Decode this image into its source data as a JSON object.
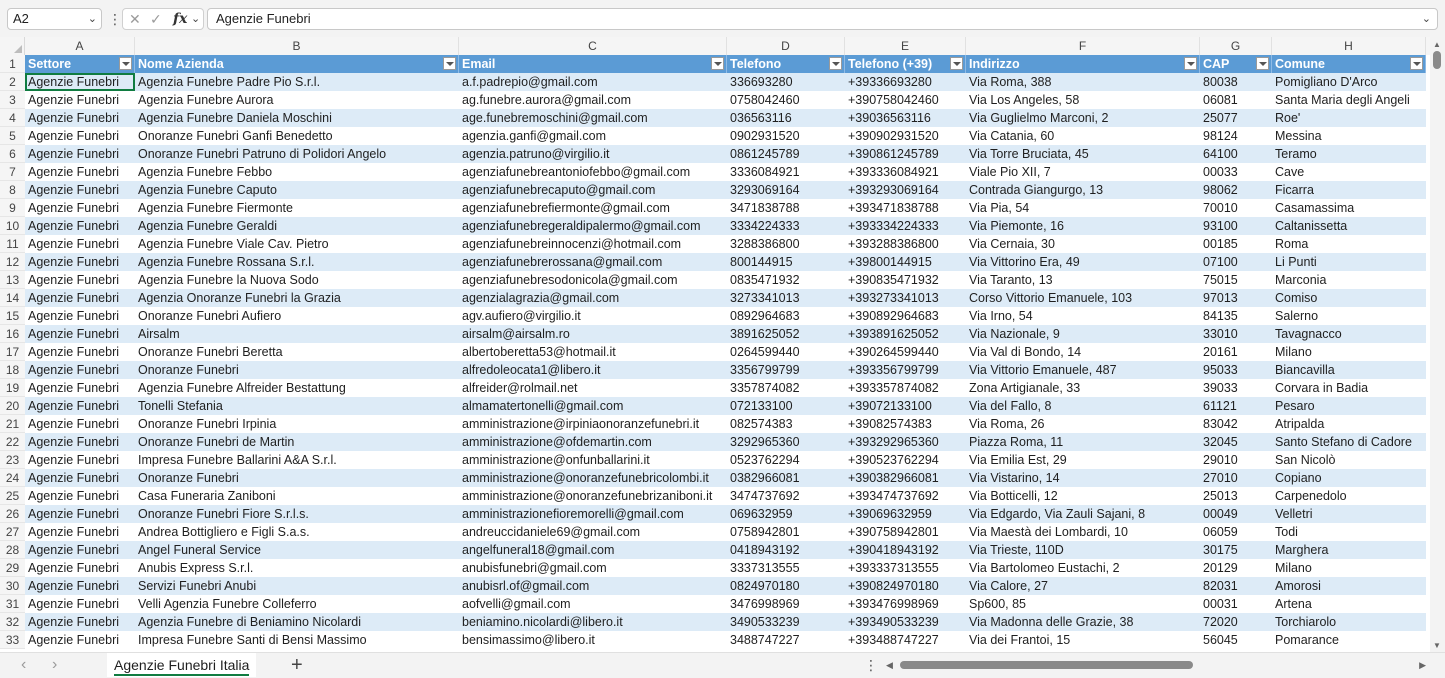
{
  "formula_bar": {
    "cell_ref": "A2",
    "fx_symbol": "fx",
    "cancel_symbol": "✕",
    "enter_symbol": "✓",
    "formula_value": "Agenzie Funebri"
  },
  "columns": [
    "A",
    "B",
    "C",
    "D",
    "E",
    "F",
    "G",
    "H"
  ],
  "header": [
    "Settore",
    "Nome Azienda",
    "Email",
    "Telefono",
    "Telefono (+39)",
    "Indirizzo",
    "CAP",
    "Comune"
  ],
  "rows": [
    [
      "Agenzie Funebri",
      "Agenzia Funebre Padre Pio S.r.l.",
      "a.f.padrepio@gmail.com",
      "336693280",
      "+39336693280",
      "Via Roma, 388",
      "80038",
      "Pomigliano D'Arco"
    ],
    [
      "Agenzie Funebri",
      "Agenzia Funebre Aurora",
      "ag.funebre.aurora@gmail.com",
      "0758042460",
      "+390758042460",
      "Via Los Angeles, 58",
      "06081",
      "Santa Maria degli Angeli"
    ],
    [
      "Agenzie Funebri",
      "Agenzia Funebre Daniela Moschini",
      "age.funebremoschini@gmail.com",
      "036563116",
      "+39036563116",
      "Via Guglielmo Marconi, 2",
      "25077",
      "Roe'"
    ],
    [
      "Agenzie Funebri",
      "Onoranze Funebri Ganfi Benedetto",
      "agenzia.ganfi@gmail.com",
      "0902931520",
      "+390902931520",
      "Via Catania, 60",
      "98124",
      "Messina"
    ],
    [
      "Agenzie Funebri",
      "Onoranze Funebri Patruno di Polidori Angelo",
      "agenzia.patruno@virgilio.it",
      "0861245789",
      "+390861245789",
      "Via Torre Bruciata, 45",
      "64100",
      "Teramo"
    ],
    [
      "Agenzie Funebri",
      "Agenzia Funebre Febbo",
      "agenziafunebreantoniofebbo@gmail.com",
      "3336084921",
      "+393336084921",
      "Viale Pio XII, 7",
      "00033",
      "Cave"
    ],
    [
      "Agenzie Funebri",
      "Agenzia Funebre Caputo",
      "agenziafunebrecaputo@gmail.com",
      "3293069164",
      "+393293069164",
      "Contrada Giangurgo, 13",
      "98062",
      "Ficarra"
    ],
    [
      "Agenzie Funebri",
      "Agenzia Funebre Fiermonte",
      "agenziafunebrefiermonte@gmail.com",
      "3471838788",
      "+393471838788",
      "Via Pia, 54",
      "70010",
      "Casamassima"
    ],
    [
      "Agenzie Funebri",
      "Agenzia Funebre Geraldi",
      "agenziafunebregeraldipalermo@gmail.com",
      "3334224333",
      "+393334224333",
      "Via Piemonte, 16",
      "93100",
      "Caltanissetta"
    ],
    [
      "Agenzie Funebri",
      "Agenzia Funebre Viale Cav. Pietro",
      "agenziafunebreinnocenzi@hotmail.com",
      "3288386800",
      "+393288386800",
      "Via Cernaia, 30",
      "00185",
      "Roma"
    ],
    [
      "Agenzie Funebri",
      "Agenzia Funebre Rossana S.r.l.",
      "agenziafunebrerossana@gmail.com",
      "800144915",
      "+39800144915",
      "Via Vittorino Era, 49",
      "07100",
      "Li Punti"
    ],
    [
      "Agenzie Funebri",
      "Agenzia Funebre la Nuova Sodo",
      "agenziafunebresodonicola@gmail.com",
      "0835471932",
      "+390835471932",
      "Via Taranto, 13",
      "75015",
      "Marconia"
    ],
    [
      "Agenzie Funebri",
      "Agenzia Onoranze Funebri la Grazia",
      "agenzialagrazia@gmail.com",
      "3273341013",
      "+393273341013",
      "Corso Vittorio Emanuele, 103",
      "97013",
      "Comiso"
    ],
    [
      "Agenzie Funebri",
      "Onoranze Funebri Aufiero",
      "agv.aufiero@virgilio.it",
      "0892964683",
      "+390892964683",
      "Via Irno, 54",
      "84135",
      "Salerno"
    ],
    [
      "Agenzie Funebri",
      "Airsalm",
      "airsalm@airsalm.ro",
      "3891625052",
      "+393891625052",
      "Via Nazionale, 9",
      "33010",
      "Tavagnacco"
    ],
    [
      "Agenzie Funebri",
      "Onoranze Funebri Beretta",
      "albertoberetta53@hotmail.it",
      "0264599440",
      "+390264599440",
      "Via Val di Bondo, 14",
      "20161",
      "Milano"
    ],
    [
      "Agenzie Funebri",
      "Onoranze Funebri",
      "alfredoleocata1@libero.it",
      "3356799799",
      "+393356799799",
      "Via Vittorio Emanuele, 487",
      "95033",
      "Biancavilla"
    ],
    [
      "Agenzie Funebri",
      "Agenzia Funebre Alfreider Bestattung",
      "alfreider@rolmail.net",
      "3357874082",
      "+393357874082",
      "Zona Artigianale, 33",
      "39033",
      "Corvara in Badia"
    ],
    [
      "Agenzie Funebri",
      "Tonelli Stefania",
      "almamatertonelli@gmail.com",
      "072133100",
      "+39072133100",
      "Via del Fallo, 8",
      "61121",
      "Pesaro"
    ],
    [
      "Agenzie Funebri",
      "Onoranze Funebri Irpinia",
      "amministrazione@irpiniaonoranzefunebri.it",
      "082574383",
      "+39082574383",
      "Via Roma, 26",
      "83042",
      "Atripalda"
    ],
    [
      "Agenzie Funebri",
      "Onoranze Funebri de Martin",
      "amministrazione@ofdemartin.com",
      "3292965360",
      "+393292965360",
      "Piazza Roma, 11",
      "32045",
      "Santo Stefano di Cadore"
    ],
    [
      "Agenzie Funebri",
      "Impresa Funebre Ballarini A&A S.r.l.",
      "amministrazione@onfunballarini.it",
      "0523762294",
      "+390523762294",
      "Via Emilia Est, 29",
      "29010",
      "San Nicolò"
    ],
    [
      "Agenzie Funebri",
      "Onoranze Funebri",
      "amministrazione@onoranzefunebricolombi.it",
      "0382966081",
      "+390382966081",
      "Via Vistarino, 14",
      "27010",
      "Copiano"
    ],
    [
      "Agenzie Funebri",
      "Casa Funeraria Zaniboni",
      "amministrazione@onoranzefunebrizaniboni.it",
      "3474737692",
      "+393474737692",
      "Via Botticelli, 12",
      "25013",
      "Carpenedolo"
    ],
    [
      "Agenzie Funebri",
      "Onoranze Funebri Fiore S.r.l.s.",
      "amministrazionefioremorelli@gmail.com",
      "069632959",
      "+39069632959",
      "Via Edgardo, Via Zauli Sajani, 8",
      "00049",
      "Velletri"
    ],
    [
      "Agenzie Funebri",
      "Andrea Bottigliero e Figli S.a.s.",
      "andreuccidaniele69@gmail.com",
      "0758942801",
      "+390758942801",
      "Via Maestà dei Lombardi, 10",
      "06059",
      "Todi"
    ],
    [
      "Agenzie Funebri",
      "Angel Funeral Service",
      "angelfuneral18@gmail.com",
      "0418943192",
      "+390418943192",
      "Via Trieste, 110D",
      "30175",
      "Marghera"
    ],
    [
      "Agenzie Funebri",
      "Anubis Express S.r.l.",
      "anubisfunebri@gmail.com",
      "3337313555",
      "+393337313555",
      "Via Bartolomeo Eustachi, 2",
      "20129",
      "Milano"
    ],
    [
      "Agenzie Funebri",
      "Servizi Funebri Anubi",
      "anubisrl.of@gmail.com",
      "0824970180",
      "+390824970180",
      "Via Calore, 27",
      "82031",
      "Amorosi"
    ],
    [
      "Agenzie Funebri",
      "Velli Agenzia Funebre Colleferro",
      "aofvelli@gmail.com",
      "3476998969",
      "+393476998969",
      "Sp600, 85",
      "00031",
      "Artena"
    ],
    [
      "Agenzie Funebri",
      "Agenzia Funebre di Beniamino Nicolardi",
      "beniamino.nicolardi@libero.it",
      "3490533239",
      "+393490533239",
      "Via Madonna delle Grazie, 38",
      "72020",
      "Torchiarolo"
    ],
    [
      "Agenzie Funebri",
      "Impresa Funebre Santi di Bensi Massimo",
      "bensimassimo@libero.it",
      "3488747227",
      "+393488747227",
      "Via dei Frantoi, 15",
      "56045",
      "Pomarance"
    ]
  ],
  "sheet_tab": "Agenzie Funebri Italia",
  "add_sheet_symbol": "+",
  "colors": {
    "header_fill": "#5b9bd5",
    "band_fill": "#ddebf7",
    "accent": "#107c41"
  }
}
